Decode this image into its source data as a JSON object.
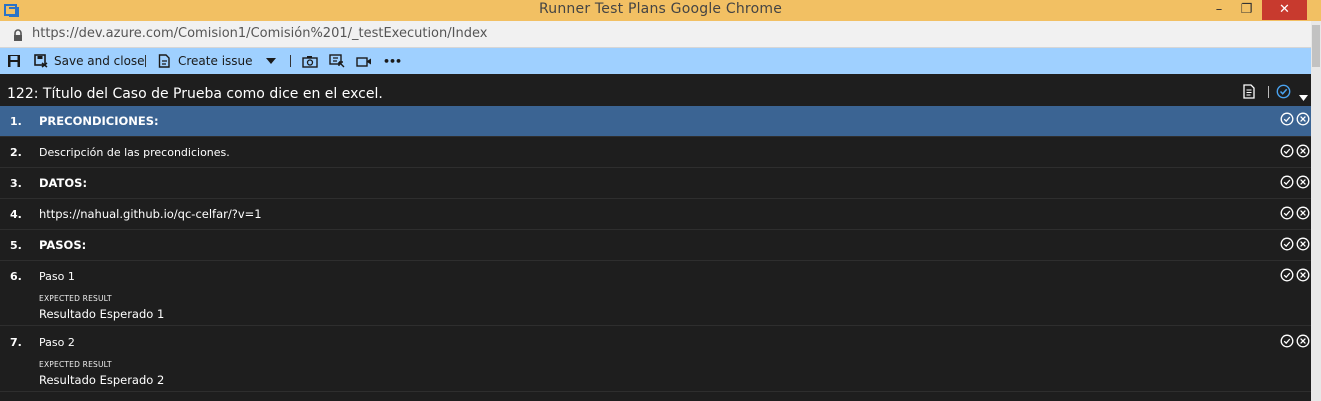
{
  "window": {
    "title": "Runner   Test Plans   Google Chrome",
    "minimize": "–",
    "maximize": "❐",
    "close": "✕"
  },
  "address": {
    "url": "https://dev.azure.com/Comision1/Comisión%201/_testExecution/Index"
  },
  "toolbar": {
    "save_close_label": "Save and close",
    "create_issue_label": "Create issue",
    "more_label": "•••"
  },
  "test_case": {
    "title": "122: Título del Caso de Prueba como dice en el excel."
  },
  "expected_label": "EXPECTED RESULT",
  "steps": [
    {
      "number": "1.",
      "action": "PRECONDICIONES:",
      "bold": true,
      "selected": true
    },
    {
      "number": "2.",
      "action": "Descripción de las precondiciones.",
      "bold": false
    },
    {
      "number": "3.",
      "action": "DATOS:",
      "bold": true
    },
    {
      "number": "4.",
      "action": "https://nahual.github.io/qc-celfar/?v=1",
      "bold": false
    },
    {
      "number": "5.",
      "action": "PASOS:",
      "bold": true
    },
    {
      "number": "6.",
      "action": "Paso 1",
      "bold": false,
      "expected": "Resultado Esperado 1"
    },
    {
      "number": "7.",
      "action": "Paso 2",
      "bold": false,
      "expected": "Resultado Esperado 2"
    }
  ],
  "colors": {
    "title_bar": "#f2c063",
    "toolbar": "#9fd0ff",
    "selected_row": "#3b6493",
    "background": "#1e1e1e",
    "close_button": "#c83a2e"
  }
}
